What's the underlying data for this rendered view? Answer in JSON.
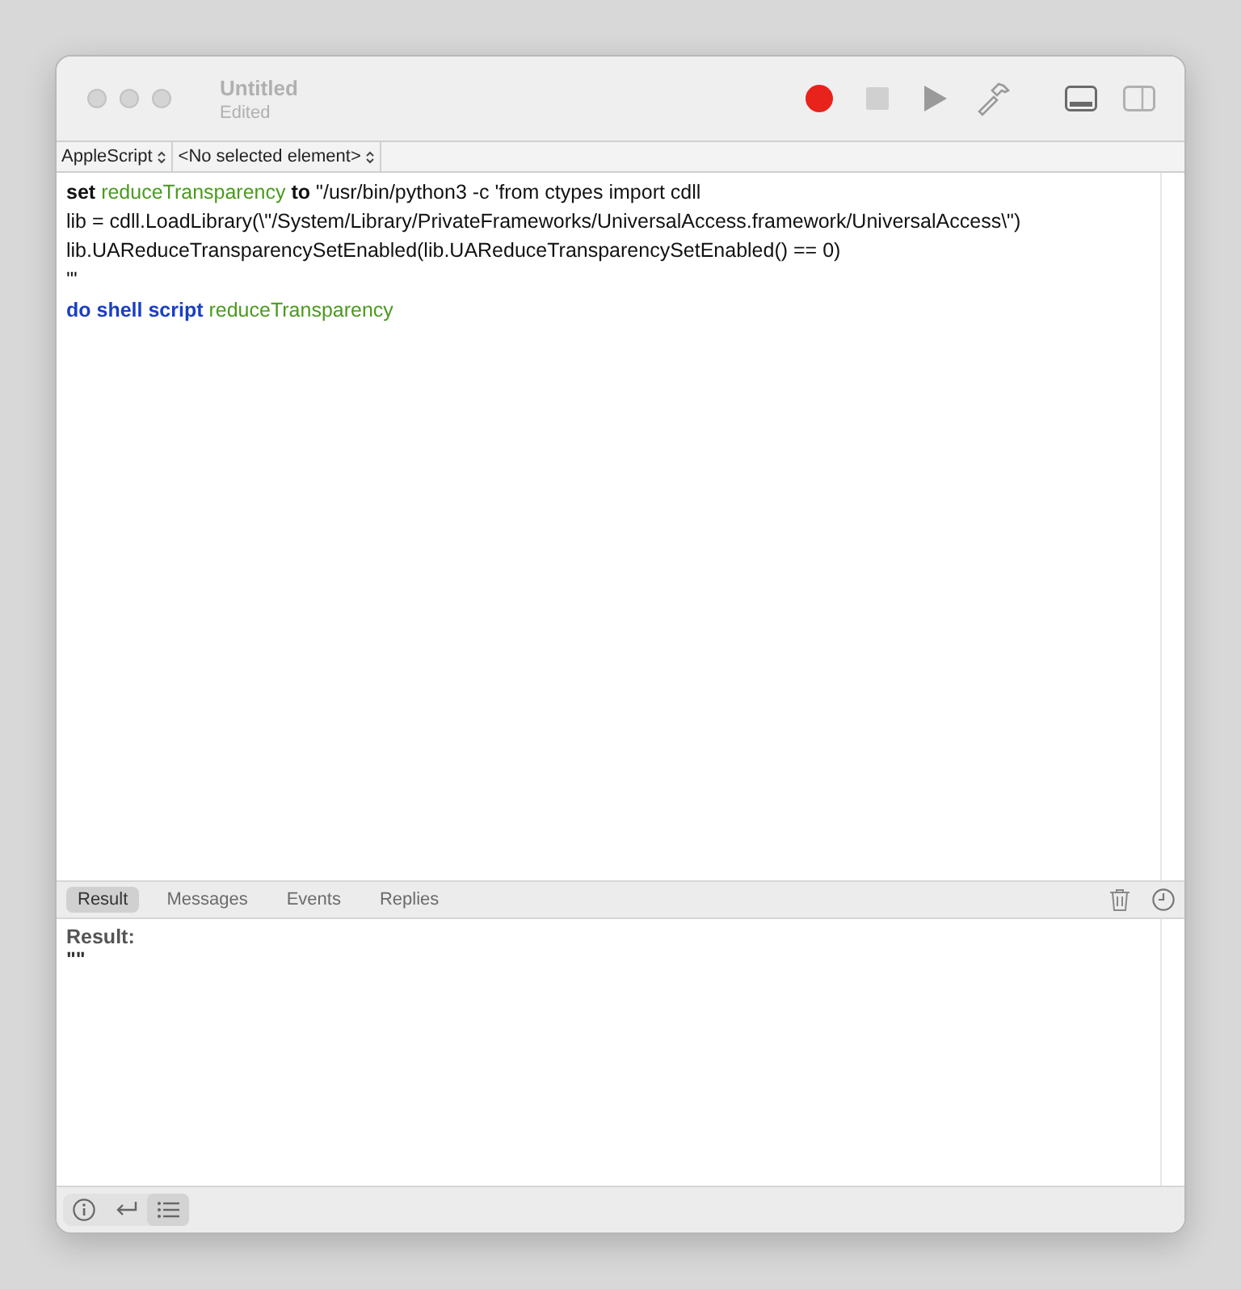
{
  "window": {
    "title": "Untitled",
    "subtitle": "Edited"
  },
  "toolbar": [
    {
      "kind": "record",
      "disabled": false
    },
    {
      "kind": "stop",
      "disabled": true
    },
    {
      "kind": "run",
      "disabled": false
    },
    {
      "kind": "compile",
      "disabled": false
    }
  ],
  "view_buttons": [
    {
      "kind": "log",
      "selected": true
    },
    {
      "kind": "sidebar",
      "selected": false
    }
  ],
  "navigation": [
    {
      "label": "AppleScript"
    },
    {
      "label": "<No selected element>"
    }
  ],
  "code": [
    [
      {
        "kind": "keyword",
        "text": "set"
      },
      {
        "kind": "variable",
        "text": "reduceTransparency"
      },
      {
        "kind": "keyword",
        "text": "to"
      },
      {
        "kind": "plain",
        "text": "\"/usr/bin/python3 -c 'from ctypes import cdll"
      }
    ],
    [
      {
        "kind": "plain",
        "text": "lib = cdll.LoadLibrary(\\\"/System/Library/PrivateFrameworks/UniversalAccess.framework/UniversalAccess\\\")"
      }
    ],
    [
      {
        "kind": "plain",
        "text": "lib.UAReduceTransparencySetEnabled(lib.UAReduceTransparencySetEnabled() == 0)"
      }
    ],
    [
      {
        "kind": "plain",
        "text": "'\""
      }
    ],
    [
      {
        "kind": "command",
        "text": "do shell script"
      },
      {
        "kind": "variable",
        "text": "reduceTransparency"
      }
    ]
  ],
  "log_tabs": [
    {
      "label": "Result",
      "selected": true
    },
    {
      "label": "Messages",
      "selected": false
    },
    {
      "label": "Events",
      "selected": false
    },
    {
      "label": "Replies",
      "selected": false
    }
  ],
  "result": {
    "heading": "Result:",
    "value": "\"\""
  },
  "bottom_buttons": [
    {
      "kind": "info",
      "selected": false
    },
    {
      "kind": "return",
      "selected": false
    },
    {
      "kind": "list",
      "selected": true
    }
  ]
}
